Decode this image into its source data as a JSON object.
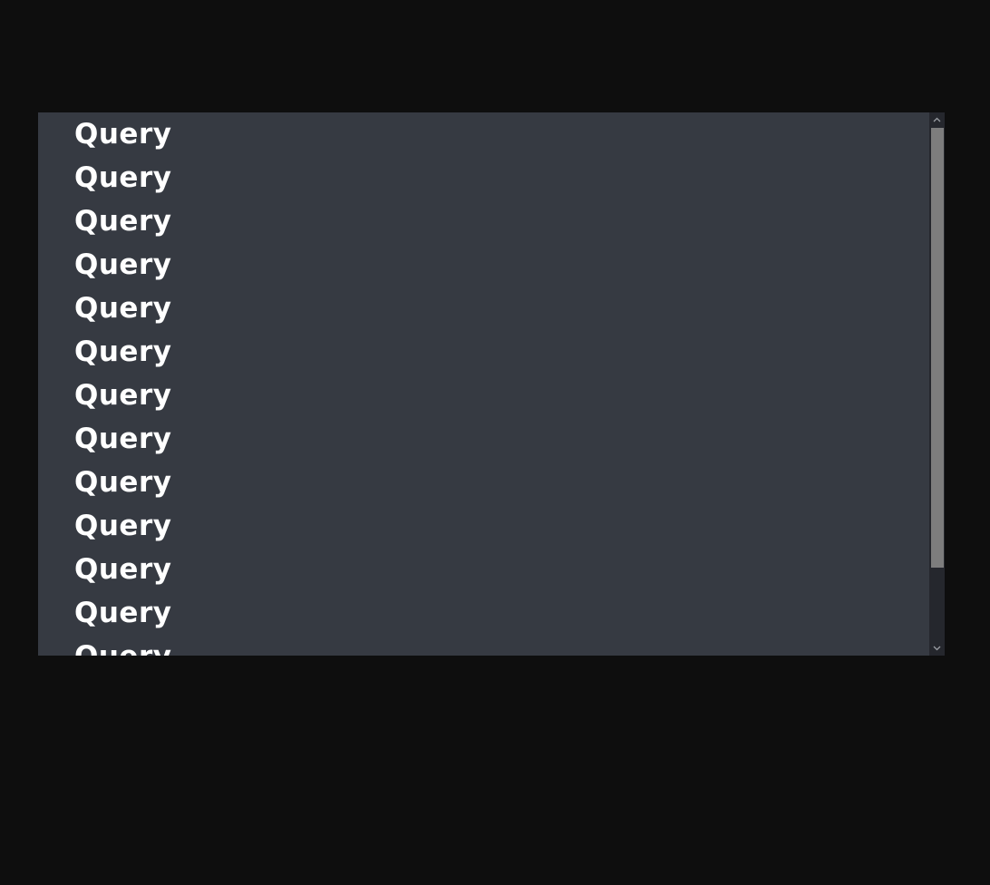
{
  "list": {
    "items": [
      "Query",
      "Query",
      "Query",
      "Query",
      "Query",
      "Query",
      "Query",
      "Query",
      "Query",
      "Query",
      "Query",
      "Query",
      "Query"
    ]
  },
  "scrollbar": {
    "up_icon": "chevron-up-icon",
    "down_icon": "chevron-down-icon",
    "thumb_fraction": 0.81,
    "scroll_position_fraction": 0
  },
  "colors": {
    "page_background": "#0e0e0e",
    "panel_background": "#363a42",
    "text": "#ffffff",
    "scrollbar_track": "#25272d",
    "scrollbar_thumb": "#7d7d7d"
  }
}
